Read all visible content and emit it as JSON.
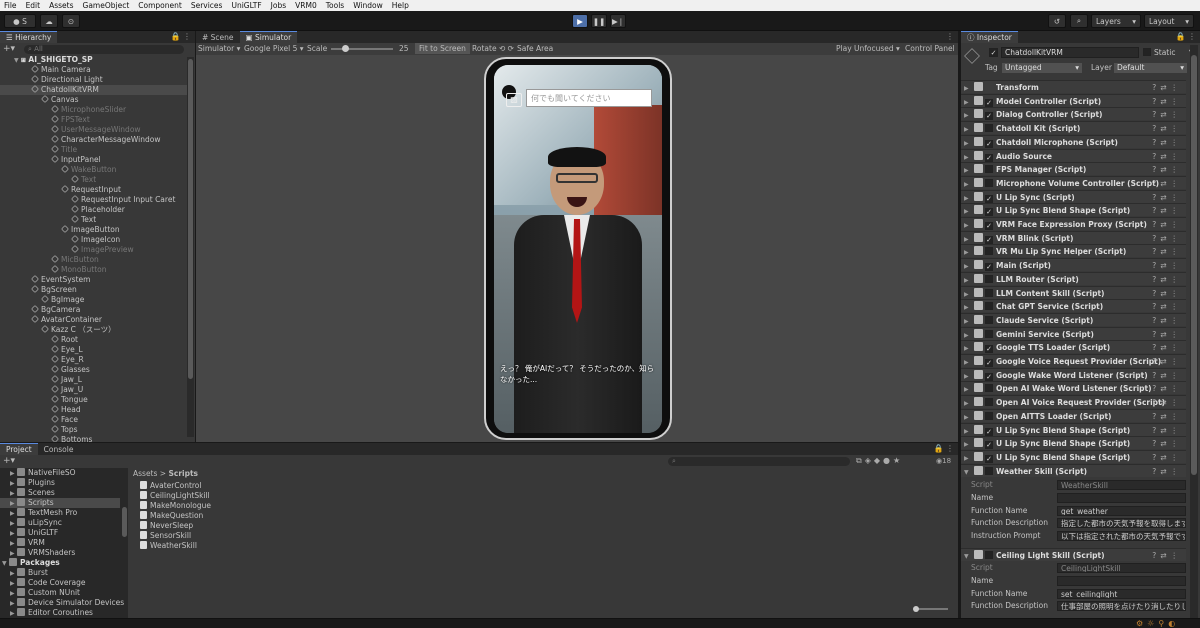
{
  "menu": [
    "File",
    "Edit",
    "Assets",
    "GameObject",
    "Component",
    "Services",
    "UniGLTF",
    "Jobs",
    "VRM0",
    "Tools",
    "Window",
    "Help"
  ],
  "toolbar": {
    "account": "S",
    "layers": "Layers",
    "layout": "Layout"
  },
  "hierarchy": {
    "tab": "Hierarchy",
    "search_placeholder": "All",
    "scene": "AI_SHIGETO_SP",
    "items": [
      {
        "label": "Main Camera",
        "depth": 1,
        "dim": false
      },
      {
        "label": "Directional Light",
        "depth": 1,
        "dim": false
      },
      {
        "label": "ChatdollKitVRM",
        "depth": 1,
        "dim": false,
        "selected": true
      },
      {
        "label": "Canvas",
        "depth": 2,
        "dim": false
      },
      {
        "label": "MicrophoneSlider",
        "depth": 3,
        "dim": true
      },
      {
        "label": "FPSText",
        "depth": 3,
        "dim": true
      },
      {
        "label": "UserMessageWindow",
        "depth": 3,
        "dim": true
      },
      {
        "label": "CharacterMessageWindow",
        "depth": 3,
        "dim": false
      },
      {
        "label": "Title",
        "depth": 3,
        "dim": true
      },
      {
        "label": "InputPanel",
        "depth": 3,
        "dim": false
      },
      {
        "label": "WakeButton",
        "depth": 4,
        "dim": true
      },
      {
        "label": "Text",
        "depth": 5,
        "dim": true
      },
      {
        "label": "RequestInput",
        "depth": 4,
        "dim": false
      },
      {
        "label": "RequestInput Input Caret",
        "depth": 5,
        "dim": false
      },
      {
        "label": "Placeholder",
        "depth": 5,
        "dim": false
      },
      {
        "label": "Text",
        "depth": 5,
        "dim": false
      },
      {
        "label": "ImageButton",
        "depth": 4,
        "dim": false
      },
      {
        "label": "ImageIcon",
        "depth": 5,
        "dim": false
      },
      {
        "label": "ImagePreview",
        "depth": 5,
        "dim": true
      },
      {
        "label": "MicButton",
        "depth": 3,
        "dim": true
      },
      {
        "label": "MonoButton",
        "depth": 3,
        "dim": true
      },
      {
        "label": "EventSystem",
        "depth": 1,
        "dim": false
      },
      {
        "label": "BgScreen",
        "depth": 1,
        "dim": false
      },
      {
        "label": "BgImage",
        "depth": 2,
        "dim": false
      },
      {
        "label": "BgCamera",
        "depth": 1,
        "dim": false
      },
      {
        "label": "AvatarContainer",
        "depth": 1,
        "dim": false
      },
      {
        "label": "Kazz C （スーツ）",
        "depth": 2,
        "dim": false
      },
      {
        "label": "Root",
        "depth": 3,
        "dim": false
      },
      {
        "label": "Eye_L",
        "depth": 3,
        "dim": false
      },
      {
        "label": "Eye_R",
        "depth": 3,
        "dim": false
      },
      {
        "label": "Glasses",
        "depth": 3,
        "dim": false
      },
      {
        "label": "Jaw_L",
        "depth": 3,
        "dim": false
      },
      {
        "label": "Jaw_U",
        "depth": 3,
        "dim": false
      },
      {
        "label": "Tongue",
        "depth": 3,
        "dim": false
      },
      {
        "label": "Head",
        "depth": 3,
        "dim": false
      },
      {
        "label": "Face",
        "depth": 3,
        "dim": false
      },
      {
        "label": "Tops",
        "depth": 3,
        "dim": false
      },
      {
        "label": "Bottoms",
        "depth": 3,
        "dim": false
      }
    ]
  },
  "scene_tabs": {
    "scene": "Scene",
    "simulator": "Simulator"
  },
  "sim_bar": {
    "mode": "Simulator",
    "device": "Google Pixel 5",
    "scale_label": "Scale",
    "scale_value": "25",
    "fit": "Fit to Screen",
    "rotate": "Rotate",
    "safe_area": "Safe Area",
    "play_mode": "Play Unfocused",
    "control_panel": "Control Panel"
  },
  "phone": {
    "input_placeholder": "何でも聞いてください",
    "message": "えっ？ 俺がAIだって？ そうだったのか、知らなかった..."
  },
  "project": {
    "tabs": [
      "Project",
      "Console"
    ],
    "breadcrumb": [
      "Assets",
      "Scripts"
    ],
    "asset_count": "18",
    "tree": [
      {
        "label": "NativeFileSO",
        "depth": 1
      },
      {
        "label": "Plugins",
        "depth": 1
      },
      {
        "label": "Scenes",
        "depth": 1
      },
      {
        "label": "Scripts",
        "depth": 1,
        "selected": true
      },
      {
        "label": "TextMesh Pro",
        "depth": 1
      },
      {
        "label": "uLipSync",
        "depth": 1
      },
      {
        "label": "UniGLTF",
        "depth": 1
      },
      {
        "label": "VRM",
        "depth": 1
      },
      {
        "label": "VRMShaders",
        "depth": 1
      },
      {
        "label": "Packages",
        "depth": 0,
        "bold": true
      },
      {
        "label": "Burst",
        "depth": 1
      },
      {
        "label": "Code Coverage",
        "depth": 1
      },
      {
        "label": "Custom NUnit",
        "depth": 1
      },
      {
        "label": "Device Simulator Devices",
        "depth": 1
      },
      {
        "label": "Editor Coroutines",
        "depth": 1
      }
    ],
    "files": [
      "AvaterControl",
      "CeilingLightSkill",
      "MakeMonologue",
      "MakeQuestion",
      "NeverSleep",
      "SensorSkill",
      "WeatherSkill"
    ]
  },
  "inspector": {
    "tab": "Inspector",
    "object_name": "ChatdollKitVRM",
    "static_label": "Static",
    "tag_label": "Tag",
    "tag_value": "Untagged",
    "layer_label": "Layer",
    "layer_value": "Default",
    "components": [
      {
        "name": "Transform",
        "checkbox": false
      },
      {
        "name": "Model Controller (Script)",
        "checkbox": true
      },
      {
        "name": "Dialog Controller (Script)",
        "checkbox": true
      },
      {
        "name": "Chatdoll Kit (Script)",
        "checkbox": false
      },
      {
        "name": "Chatdoll Microphone (Script)",
        "checkbox": true
      },
      {
        "name": "Audio Source",
        "checkbox": true
      },
      {
        "name": "FPS Manager (Script)",
        "checkbox": false
      },
      {
        "name": "Microphone Volume Controller (Script)",
        "checkbox": false
      },
      {
        "name": "U Lip Sync (Script)",
        "checkbox": true
      },
      {
        "name": "U Lip Sync Blend Shape (Script)",
        "checkbox": true
      },
      {
        "name": "VRM Face Expression Proxy (Script)",
        "checkbox": true
      },
      {
        "name": "VRM Blink (Script)",
        "checkbox": true
      },
      {
        "name": "VR Mu Lip Sync Helper (Script)",
        "checkbox": false
      },
      {
        "name": "Main (Script)",
        "checkbox": true
      },
      {
        "name": "LLM Router (Script)",
        "checkbox": false
      },
      {
        "name": "LLM Content Skill (Script)",
        "checkbox": false
      },
      {
        "name": "Chat GPT Service (Script)",
        "checkbox": false
      },
      {
        "name": "Claude Service (Script)",
        "checkbox": false
      },
      {
        "name": "Gemini Service (Script)",
        "checkbox": false
      },
      {
        "name": "Google TTS Loader (Script)",
        "checkbox": true
      },
      {
        "name": "Google Voice Request Provider (Script)",
        "checkbox": true
      },
      {
        "name": "Google Wake Word Listener (Script)",
        "checkbox": true
      },
      {
        "name": "Open AI Wake Word Listener (Script)",
        "checkbox": false
      },
      {
        "name": "Open AI Voice Request Provider (Script)",
        "checkbox": false
      },
      {
        "name": "Open AITTS Loader (Script)",
        "checkbox": false
      },
      {
        "name": "U Lip Sync Blend Shape (Script)",
        "checkbox": true
      },
      {
        "name": "U Lip Sync Blend Shape (Script)",
        "checkbox": true
      },
      {
        "name": "U Lip Sync Blend Shape (Script)",
        "checkbox": true
      },
      {
        "name": "Weather Skill (Script)",
        "checkbox": false
      }
    ],
    "weather_props": [
      {
        "label": "Script",
        "value": "WeatherSkill"
      },
      {
        "label": "Name",
        "value": ""
      },
      {
        "label": "Function Name",
        "value": "get_weather"
      },
      {
        "label": "Function Description",
        "value": "指定した都市の天気予報を取得します。都"
      },
      {
        "label": "Instruction Prompt",
        "value": "以下は指定された都市の天気予報です。あ"
      }
    ],
    "ceiling_header": "Ceiling Light Skill (Script)",
    "ceiling_props": [
      {
        "label": "Script",
        "value": "CeilingLightSkill"
      },
      {
        "label": "Name",
        "value": ""
      },
      {
        "label": "Function Name",
        "value": "set_ceilinglight"
      },
      {
        "label": "Function Description",
        "value": "仕事部屋の照明を点けたり消したりします。"
      }
    ]
  }
}
